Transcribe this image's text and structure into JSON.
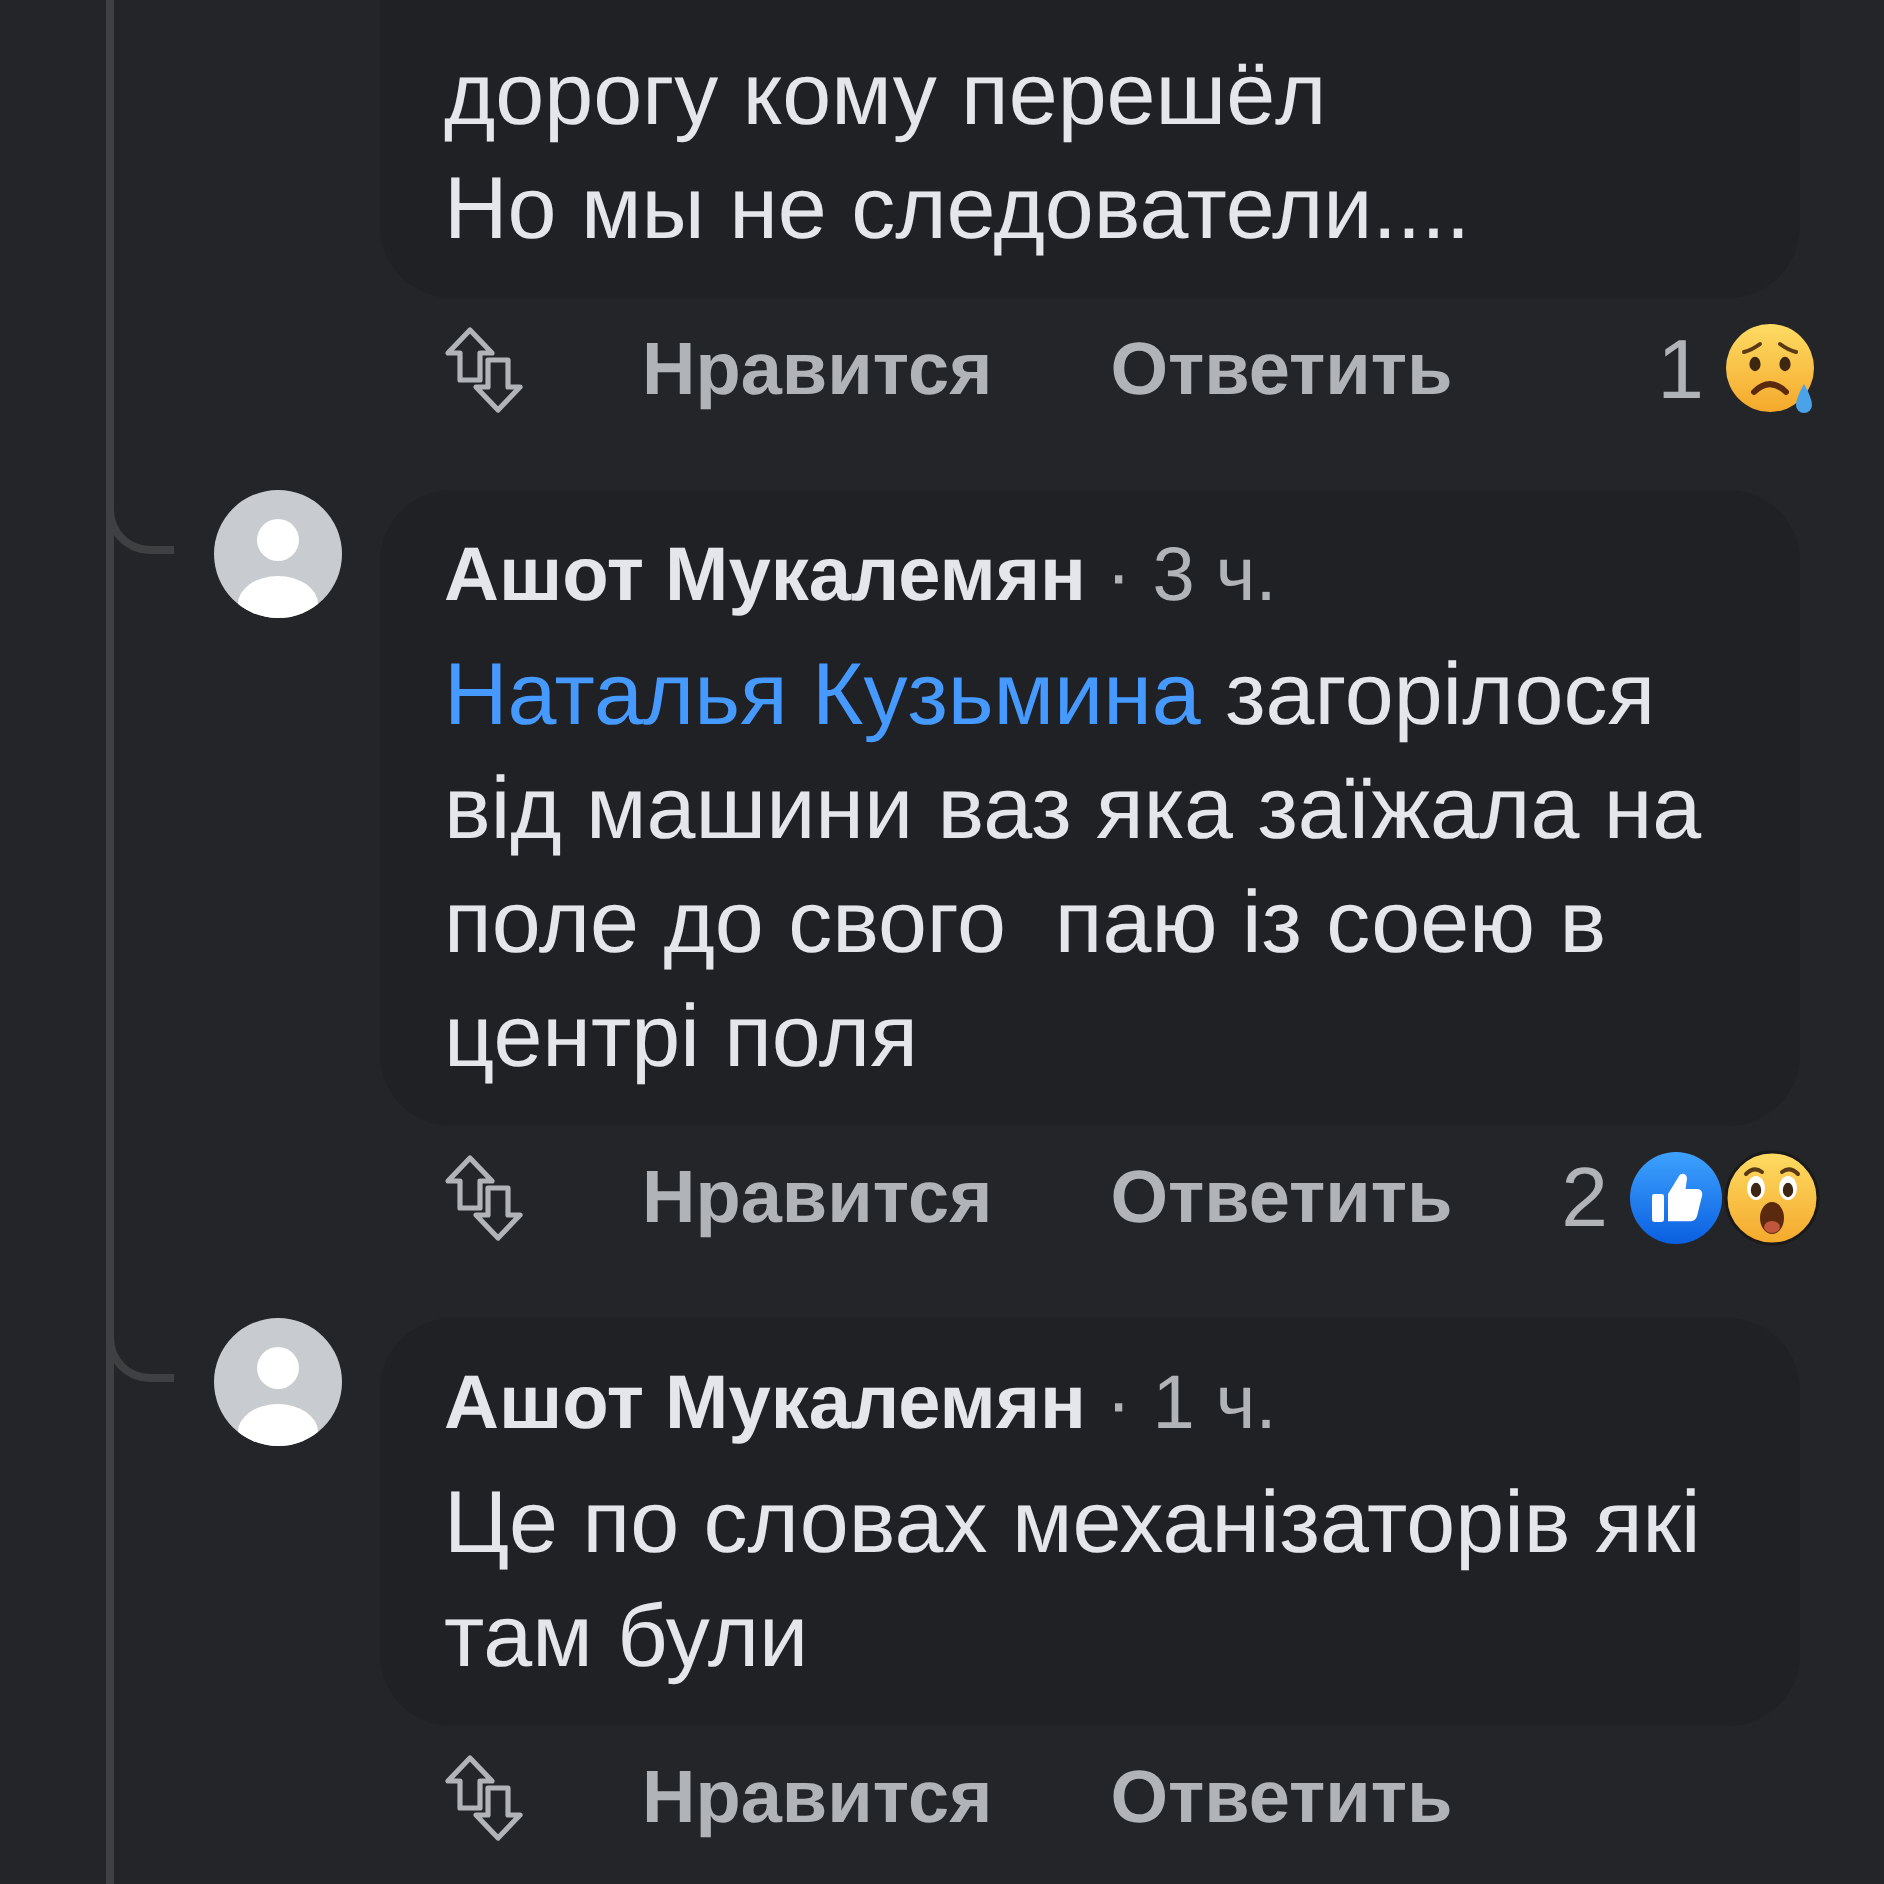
{
  "thread": {
    "comments": [
      {
        "text": "дорогу кому перешёл\nНо мы не следователи....",
        "like_label": "Нравится",
        "reply_label": "Ответить",
        "reaction_count": "1",
        "reactions": [
          {
            "kind": "sad"
          }
        ]
      },
      {
        "author": "Ашот Мукалемян",
        "time": "· 3 ч.",
        "mention": "Наталья Кузьмина",
        "text": "загорілося\nвід машини ваз яка заїжала на\nполе до свого  паю із соею в\nцентрі поля",
        "like_label": "Нравится",
        "reply_label": "Ответить",
        "reaction_count": "2",
        "reactions": [
          {
            "kind": "like"
          },
          {
            "kind": "wow"
          }
        ]
      },
      {
        "author": "Ашот Мукалемян",
        "time": "· 1 ч.",
        "text": "Це по словах механізаторів які\nтам були",
        "like_label": "Нравится",
        "reply_label": "Ответить"
      }
    ]
  }
}
